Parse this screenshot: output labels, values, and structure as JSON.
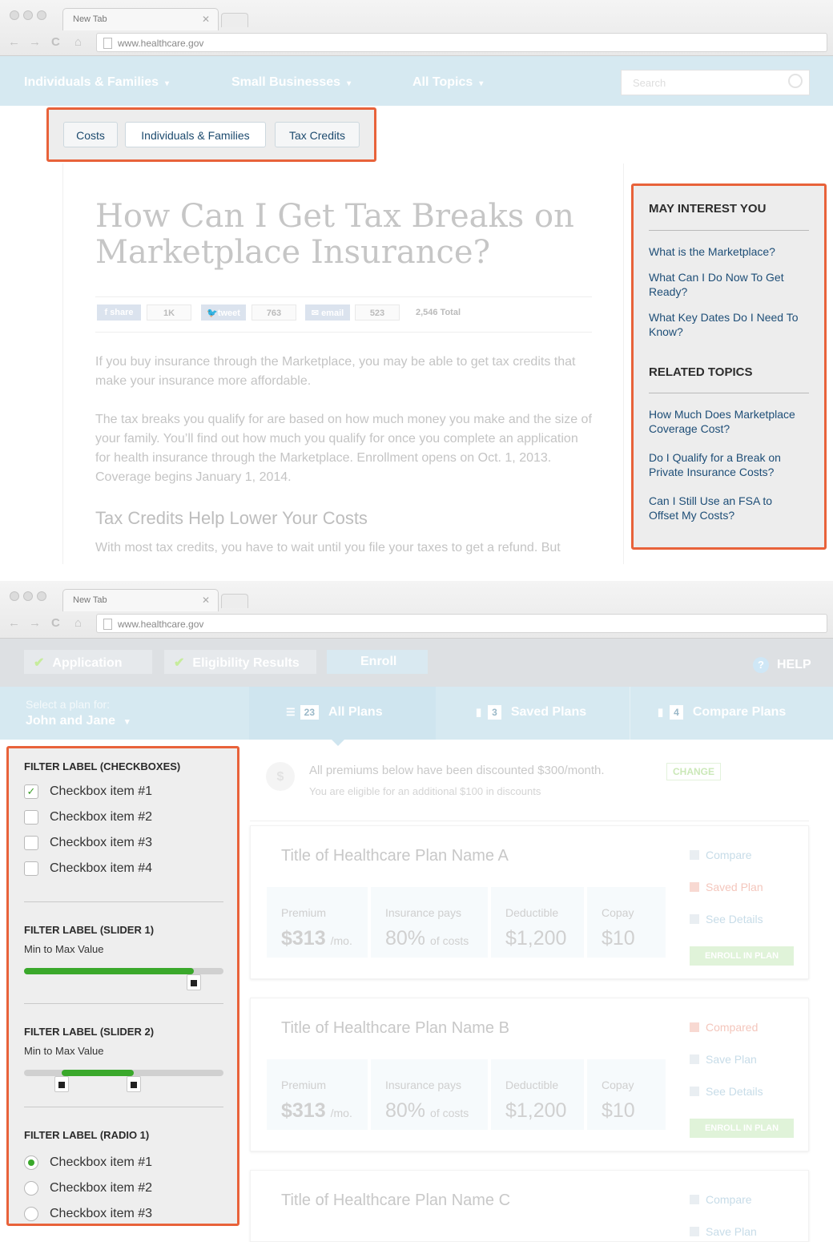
{
  "browser": {
    "tab_title": "New Tab",
    "url": "www.healthcare.gov"
  },
  "top_nav": {
    "items": [
      "Individuals & Families",
      "Small Businesses",
      "All Topics"
    ],
    "search_placeholder": "Search"
  },
  "breadcrumb": [
    "Costs",
    "Individuals & Families",
    "Tax Credits"
  ],
  "article": {
    "title": "How Can I Get Tax Breaks on Marketplace Insurance?",
    "social": {
      "share_label": "share",
      "share_count": "1K",
      "tweet_label": "tweet",
      "tweet_count": "763",
      "email_label": "email",
      "email_count": "523",
      "total": "2,546 Total"
    },
    "paragraphs": [
      "If you buy insurance through the Marketplace, you may be able to get tax credits that make your insurance more affordable.",
      "The tax breaks you qualify for are based on how much money you make and the size of your family. You’ll find out how much you qualify for once you complete an application for health insurance through the Marketplace. Enrollment opens on Oct. 1, 2013. Coverage begins January 1, 2014."
    ],
    "subheading": "Tax Credits Help Lower Your Costs",
    "paragraph3": "With most tax credits, you have to wait until you file your taxes to get a refund. But"
  },
  "sidebar": {
    "may_interest_heading": "MAY INTEREST YOU",
    "may_interest_links": [
      "What is the Marketplace?",
      "What Can I Do Now To Get Ready?",
      "What Key Dates Do I Need To Know?"
    ],
    "related_heading": "RELATED TOPICS",
    "related_links": [
      "How Much Does Marketplace Coverage Cost?",
      "Do I Qualify for a Break on Private Insurance Costs?",
      "Can I Still Use an FSA to Offset My Costs?"
    ]
  },
  "steps": {
    "items": [
      "Application",
      "Eligibility Results",
      "Enroll"
    ],
    "help_label": "HELP",
    "help_glyph": "?"
  },
  "plan_selector": {
    "prompt": "Select a plan for:",
    "value": "John and Jane",
    "tabs": [
      {
        "count": "23",
        "label": "All Plans"
      },
      {
        "count": "3",
        "label": "Saved Plans"
      },
      {
        "count": "4",
        "label": "Compare Plans"
      }
    ]
  },
  "notice": {
    "icon_glyph": "$",
    "line1": "All premiums below have been discounted $300/month.",
    "line2": "You are eligible for an additional $100 in discounts",
    "change_label": "CHANGE"
  },
  "plans": [
    {
      "title": "Title of Healthcare Plan Name A",
      "premium_label": "Premium",
      "premium": "$313",
      "premium_unit": "/mo.",
      "pays_label": "Insurance pays",
      "pays": "80%",
      "pays_unit": "of costs",
      "deductible_label": "Deductible",
      "deductible": "$1,200",
      "copay_label": "Copay",
      "copay": "$10",
      "compare": "Compare",
      "save": "Saved Plan",
      "details": "See Details",
      "enroll": "ENROLL IN PLAN"
    },
    {
      "title": "Title of Healthcare Plan Name B",
      "premium_label": "Premium",
      "premium": "$313",
      "premium_unit": "/mo.",
      "pays_label": "Insurance pays",
      "pays": "80%",
      "pays_unit": "of costs",
      "deductible_label": "Deductible",
      "deductible": "$1,200",
      "copay_label": "Copay",
      "copay": "$10",
      "compare": "Compared",
      "save": "Save Plan",
      "details": "See Details",
      "enroll": "ENROLL IN PLAN"
    },
    {
      "title": "Title of Healthcare Plan Name C",
      "compare": "Compare",
      "save": "Save Plan"
    }
  ],
  "filters": {
    "checkbox_group": {
      "label": "FILTER LABEL (CHECKBOXES)",
      "items": [
        "Checkbox item #1",
        "Checkbox item #2",
        "Checkbox item #3",
        "Checkbox item #4"
      ],
      "checked": [
        true,
        false,
        false,
        false
      ],
      "check_glyph": "✓"
    },
    "slider1": {
      "label": "FILTER LABEL (SLIDER 1)",
      "sub": "Min to Max Value",
      "value": 0.85
    },
    "slider2": {
      "label": "FILTER LABEL (SLIDER 2)",
      "sub": "Min to Max Value",
      "min": 0.19,
      "max": 0.55
    },
    "radio_group": {
      "label": "FILTER LABEL (RADIO 1)",
      "items": [
        "Checkbox item #1",
        "Checkbox item #2",
        "Checkbox item #3"
      ],
      "selected": 0
    }
  },
  "colors": {
    "highlight": "#e8623a",
    "nav_bg": "#d6e9f1",
    "link": "#1e4e77",
    "accent_green": "#3aa82b"
  }
}
